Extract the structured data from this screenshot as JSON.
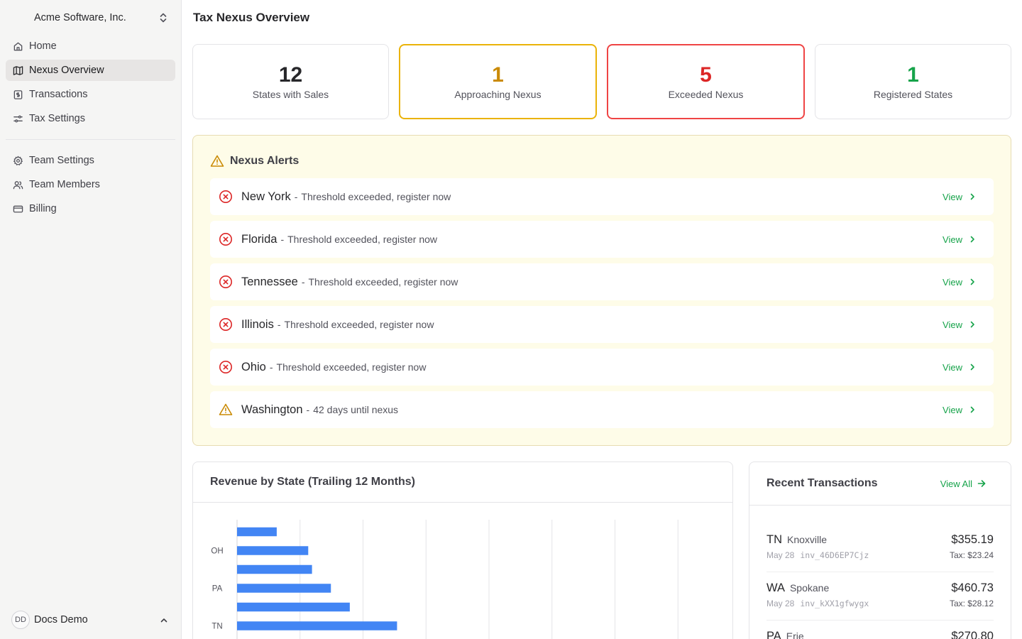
{
  "sidebar": {
    "org_name": "Acme Software, Inc.",
    "nav_primary": [
      {
        "label": "Home",
        "icon": "home-icon",
        "active": false
      },
      {
        "label": "Nexus Overview",
        "icon": "map-icon",
        "active": true
      },
      {
        "label": "Transactions",
        "icon": "receipt-icon",
        "active": false
      },
      {
        "label": "Tax Settings",
        "icon": "sliders-icon",
        "active": false
      }
    ],
    "nav_secondary": [
      {
        "label": "Team Settings",
        "icon": "gear-icon"
      },
      {
        "label": "Team Members",
        "icon": "users-icon"
      },
      {
        "label": "Billing",
        "icon": "credit-card-icon"
      }
    ],
    "user": {
      "initials": "DD",
      "name": "Docs Demo"
    }
  },
  "page": {
    "title": "Tax Nexus Overview"
  },
  "stats": [
    {
      "value": "12",
      "label": "States with Sales",
      "color": "#27272a"
    },
    {
      "value": "1",
      "label": "Approaching Nexus",
      "color": "#ca8a04"
    },
    {
      "value": "5",
      "label": "Exceeded Nexus",
      "color": "#dc2626"
    },
    {
      "value": "1",
      "label": "Registered States",
      "color": "#16a34a"
    }
  ],
  "alerts": {
    "title": "Nexus Alerts",
    "items": [
      {
        "state": "New York",
        "message": "Threshold exceeded, register now",
        "level": "exceeded",
        "view": "View"
      },
      {
        "state": "Florida",
        "message": "Threshold exceeded, register now",
        "level": "exceeded",
        "view": "View"
      },
      {
        "state": "Tennessee",
        "message": "Threshold exceeded, register now",
        "level": "exceeded",
        "view": "View"
      },
      {
        "state": "Illinois",
        "message": "Threshold exceeded, register now",
        "level": "exceeded",
        "view": "View"
      },
      {
        "state": "Ohio",
        "message": "Threshold exceeded, register now",
        "level": "exceeded",
        "view": "View"
      },
      {
        "state": "Washington",
        "message": "42 days until nexus",
        "level": "approaching",
        "view": "View"
      }
    ]
  },
  "revenue": {
    "title": "Revenue by State (Trailing 12 Months)"
  },
  "chart_data": {
    "type": "bar",
    "orientation": "horizontal",
    "categories": [
      "",
      "OH",
      "",
      "PA",
      "",
      "TN"
    ],
    "values": [
      6.3,
      11.3,
      11.9,
      14.9,
      17.9,
      25.4
    ],
    "xlim": [
      0,
      80
    ],
    "grid": true,
    "bar_color": "#4285f4"
  },
  "transactions": {
    "title": "Recent Transactions",
    "view_all": "View All",
    "items": [
      {
        "state": "TN",
        "city": "Knoxville",
        "date": "May 28",
        "id": "inv_46D6EP7Cjz",
        "amount": "$355.19",
        "tax": "Tax: $23.24"
      },
      {
        "state": "WA",
        "city": "Spokane",
        "date": "May 28",
        "id": "inv_kXX1gfwygx",
        "amount": "$460.73",
        "tax": "Tax: $28.12"
      },
      {
        "state": "PA",
        "city": "Erie",
        "date": "",
        "id": "",
        "amount": "$270.80",
        "tax": ""
      }
    ]
  }
}
